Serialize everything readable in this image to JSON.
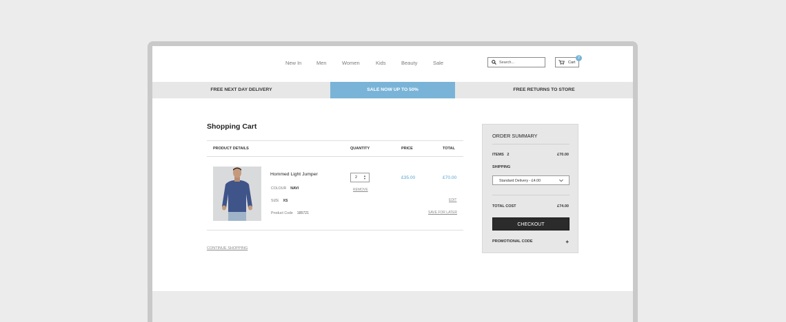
{
  "nav": {
    "items": [
      "New In",
      "Men",
      "Women",
      "Kids",
      "Beauty",
      "Sale"
    ]
  },
  "search": {
    "placeholder": "Search...",
    "icon": "search-icon"
  },
  "cart": {
    "label": "Cart",
    "count": "2",
    "icon": "cart-icon"
  },
  "promo": {
    "items": [
      "FREE NEXT DAY DELIVERY",
      "SALE NOW UP TO 50%",
      "FREE RETURNS TO STORE"
    ],
    "active_index": 1,
    "active_color": "#79b4d8"
  },
  "cart_page": {
    "title": "Shopping Cart",
    "columns": [
      "PRODUCT DETAILS",
      "QUANTITY",
      "PRICE",
      "TOTAL"
    ],
    "item": {
      "name": "Hommed Light Jumper",
      "colour_label": "COLOUR",
      "colour_value": "NAVI",
      "size_label": "SIZE",
      "size_value": "XS",
      "code_label": "Product Code",
      "code_value": "185721",
      "quantity": "2",
      "remove_label": "REMOVE",
      "price": "£35.00",
      "total": "£70.00",
      "edit_label": "EDIT",
      "save_label": "SAVE FOR LATER"
    },
    "continue_label": "CONTINUE SHOPPING"
  },
  "summary": {
    "title": "ORDER SUMMARY",
    "items_label": "ITEMS",
    "items_count": "2",
    "items_value": "£70.00",
    "shipping_label": "SHIPPING",
    "shipping_option": "Standard Delivery - £4.00",
    "total_label": "TOTAL COST",
    "total_value": "£74.00",
    "checkout_label": "CHECKOUT",
    "promo_label": "PROMOTIONAL CODE",
    "promo_toggle": "+"
  },
  "colors": {
    "accent": "#79b4d8",
    "price": "#5aa2cf",
    "checkout": "#2b2b2b"
  }
}
